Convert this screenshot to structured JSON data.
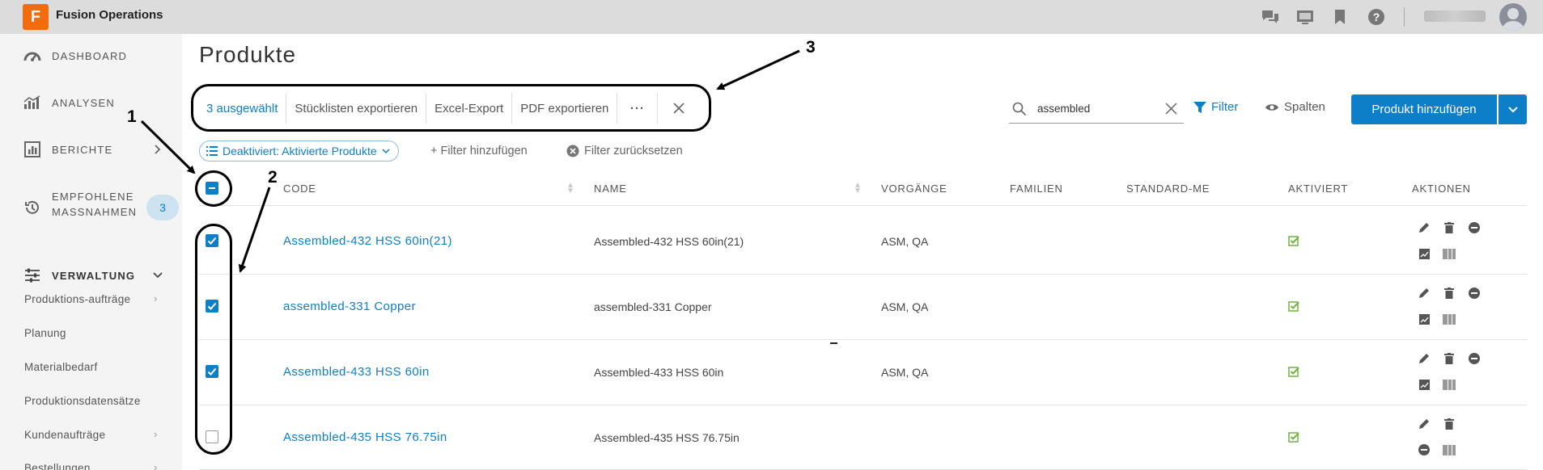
{
  "app": {
    "name": "Fusion Operations",
    "logo_letter": "F"
  },
  "topbar": {
    "icons": [
      "chat-icon",
      "monitor-icon",
      "bookmark-icon",
      "help-icon"
    ]
  },
  "sidebar": {
    "main_items": [
      {
        "label": "DASHBOARD",
        "icon": "gauge-icon"
      },
      {
        "label": "ANALYSEN",
        "icon": "bar-chart-icon"
      },
      {
        "label": "BERICHTE",
        "icon": "report-icon"
      },
      {
        "label": "EMPFOHLENE",
        "label2": "MASSNAHMEN",
        "icon": "history-icon",
        "badge": "3"
      },
      {
        "label": "VERWALTUNG",
        "icon": "sliders-icon"
      }
    ],
    "sub_items": [
      {
        "label": "Produktions-aufträge",
        "chevron": "›"
      },
      {
        "label": "Planung"
      },
      {
        "label": "Materialbedarf"
      },
      {
        "label": "Produktionsdatensätze"
      },
      {
        "label": "Kundenaufträge",
        "chevron": "›"
      },
      {
        "label": "Bestellungen",
        "chevron": "›"
      }
    ]
  },
  "page": {
    "title": "Produkte"
  },
  "selection_bar": {
    "selected_label": "3 ausgewählt",
    "export_bom": "Stücklisten exportieren",
    "excel_export": "Excel-Export",
    "pdf_export": "PDF exportieren",
    "more": "···"
  },
  "search": {
    "value": "assembled"
  },
  "toolbar": {
    "filter_label": "Filter",
    "columns_label": "Spalten",
    "add_label": "Produkt hinzufügen"
  },
  "filters": {
    "active_chip": "Deaktiviert: Aktivierte Produkte",
    "add_filter": "+ Filter hinzufügen",
    "reset_filter": "Filter zurücksetzen"
  },
  "table": {
    "columns": [
      "CODE",
      "NAME",
      "VORGÄNGE",
      "FAMILIEN",
      "STANDARD-ME",
      "AKTIVIERT",
      "AKTIONEN"
    ],
    "rows": [
      {
        "code": "Assembled-432 HSS 60in(21)",
        "name": "Assembled-432 HSS 60in(21)",
        "vorgaenge": "ASM, QA",
        "checked": true
      },
      {
        "code": "assembled-331 Copper",
        "name": "assembled-331 Copper",
        "vorgaenge": "ASM, QA",
        "checked": true
      },
      {
        "code": "Assembled-433 HSS 60in",
        "name": "Assembled-433 HSS 60in",
        "vorgaenge": "ASM, QA",
        "checked": true
      },
      {
        "code": "Assembled-435 HSS 76.75in",
        "name": "Assembled-435 HSS 76.75in",
        "vorgaenge": "",
        "checked": false
      }
    ]
  },
  "annotations": {
    "label_1": "1",
    "label_2": "2",
    "label_3": "3"
  },
  "colors": {
    "accent": "#0d7fc8",
    "brand": "#f26b0f",
    "sidebar_bg": "#f4f4f4",
    "topbar_bg": "#dcdcdc",
    "ok_green": "#6fb23f"
  }
}
